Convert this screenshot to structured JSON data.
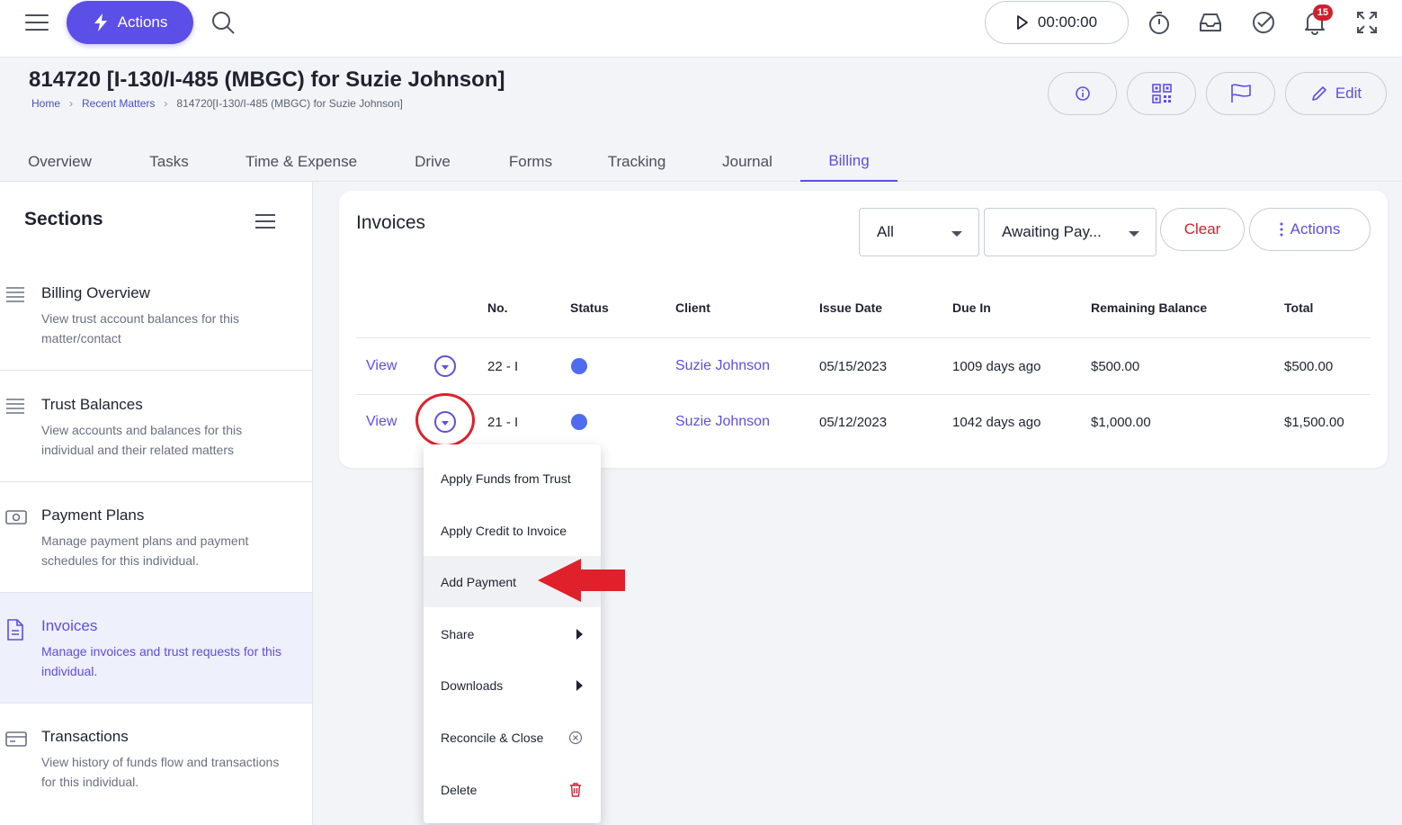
{
  "topbar": {
    "actions_label": "Actions",
    "timer": "00:00:00",
    "notification_count": "15"
  },
  "header": {
    "title": "814720 [I-130/I-485 (MBGC) for Suzie Johnson]",
    "breadcrumb": [
      "Home",
      "Recent Matters",
      "814720[I-130/I-485 (MBGC) for Suzie Johnson]"
    ],
    "edit_label": "Edit"
  },
  "tabs": [
    {
      "label": "Overview"
    },
    {
      "label": "Tasks"
    },
    {
      "label": "Time & Expense"
    },
    {
      "label": "Drive"
    },
    {
      "label": "Forms"
    },
    {
      "label": "Tracking"
    },
    {
      "label": "Journal"
    },
    {
      "label": "Billing",
      "active": true
    }
  ],
  "sidebar": {
    "title": "Sections",
    "items": [
      {
        "title": "Billing Overview",
        "desc": "View trust account balances for this matter/contact"
      },
      {
        "title": "Trust Balances",
        "desc": "View accounts and balances for this individual and their related matters"
      },
      {
        "title": "Payment Plans",
        "desc": "Manage payment plans and payment schedules for this individual."
      },
      {
        "title": "Invoices",
        "desc": "Manage invoices and trust requests for this individual.",
        "active": true
      },
      {
        "title": "Transactions",
        "desc": "View history of funds flow and transactions for this individual."
      }
    ]
  },
  "invoices": {
    "title": "Invoices",
    "filter_type": "All",
    "filter_status": "Awaiting Pay...",
    "clear_label": "Clear",
    "actions_label": "Actions",
    "columns": [
      "No.",
      "Status",
      "Client",
      "Issue Date",
      "Due In",
      "Remaining Balance",
      "Total"
    ],
    "rows": [
      {
        "view": "View",
        "no": "22 - I",
        "client": "Suzie Johnson",
        "issue_date": "05/15/2023",
        "due_in": "1009 days ago",
        "remaining": "$500.00",
        "total": "$500.00"
      },
      {
        "view": "View",
        "no": "21 - I",
        "client": "Suzie Johnson",
        "issue_date": "05/12/2023",
        "due_in": "1042 days ago",
        "remaining": "$1,000.00",
        "total": "$1,500.00"
      }
    ]
  },
  "row_menu": {
    "items": [
      "Apply Funds from Trust",
      "Apply Credit to Invoice",
      "Add Payment",
      "Share",
      "Downloads",
      "Reconcile & Close",
      "Delete"
    ]
  },
  "colors": {
    "accent": "#5b4fe8",
    "danger": "#d0202e",
    "annotation": "#e0202a",
    "status_blue": "#4d6cf0"
  }
}
